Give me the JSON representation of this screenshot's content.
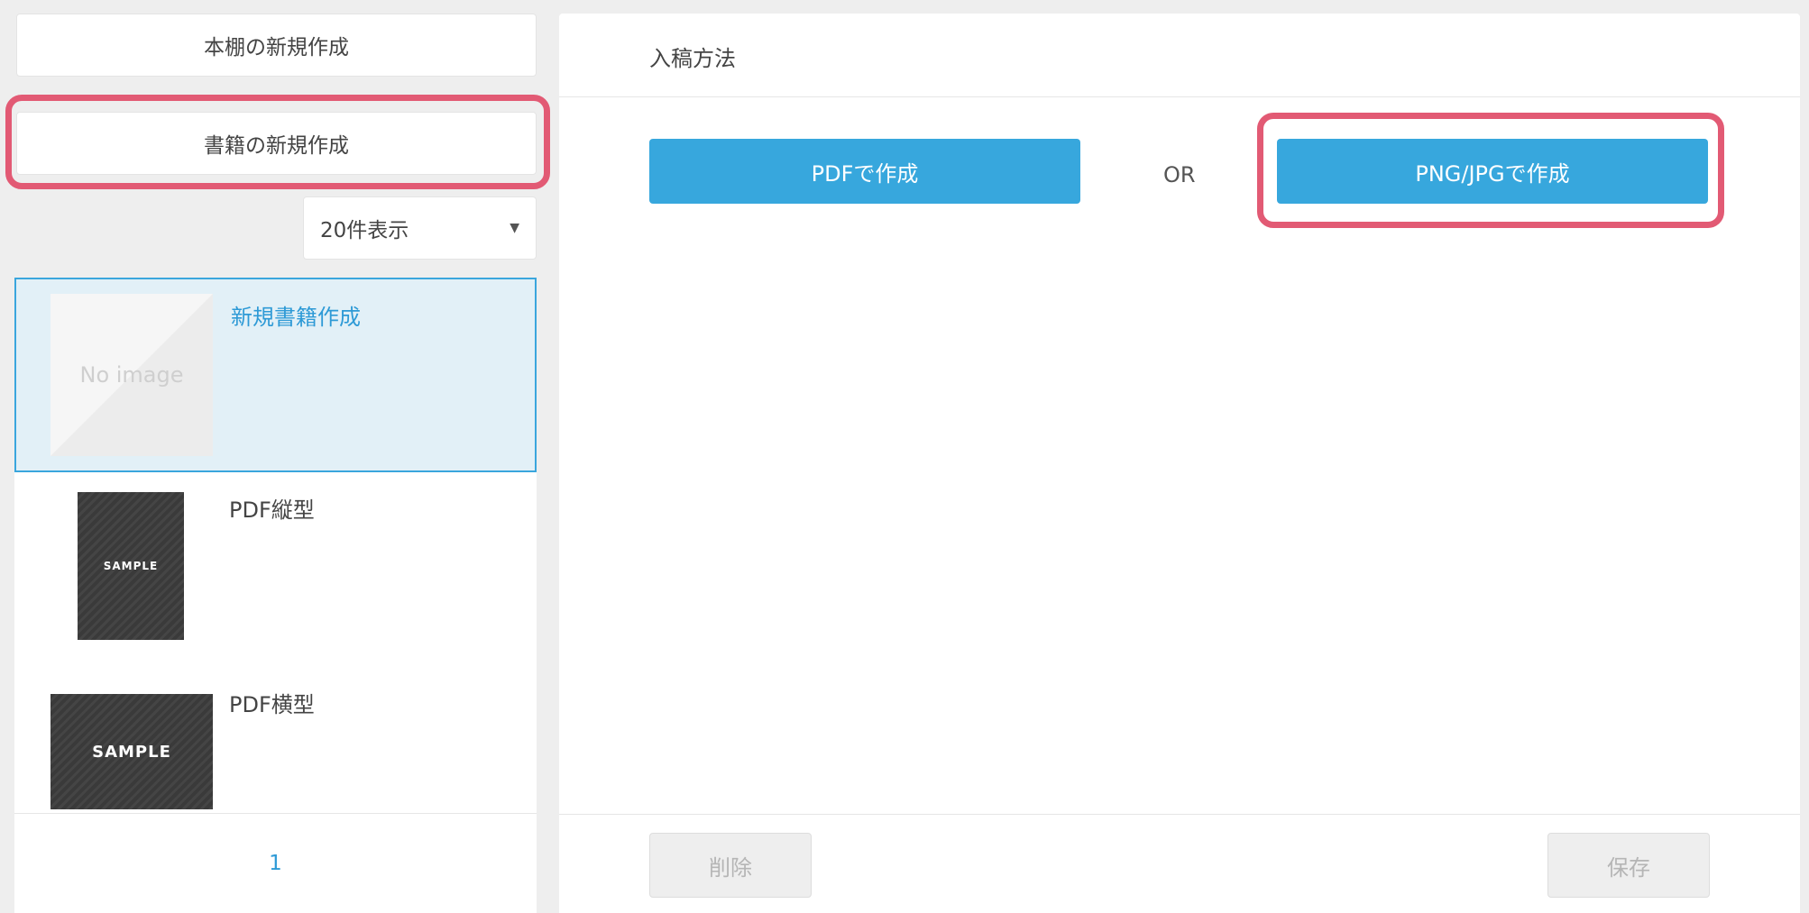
{
  "sidebar": {
    "new_shelf_label": "本棚の新規作成",
    "new_book_label": "書籍の新規作成",
    "per_page": {
      "selected": "20件表示",
      "caret": "▼"
    },
    "books": [
      {
        "title": "新規書籍作成",
        "thumbnail_text": "No image",
        "selected": true
      },
      {
        "title": "PDF縦型",
        "thumbnail_text": "SAMPLE",
        "selected": false
      },
      {
        "title": "PDF横型",
        "thumbnail_text": "SAMPLE",
        "selected": false
      }
    ],
    "pagination": {
      "current_page": "1"
    }
  },
  "main": {
    "section_title": "入稿方法",
    "pdf_button_label": "PDFで作成",
    "or_label": "OR",
    "png_button_label": "PNG/JPGで作成",
    "delete_button_label": "削除",
    "save_button_label": "保存"
  },
  "colors": {
    "accent": "#37a7dd",
    "highlight": "#e25a74",
    "selected_bg": "#e2f0f7",
    "link": "#2e9ad6"
  }
}
